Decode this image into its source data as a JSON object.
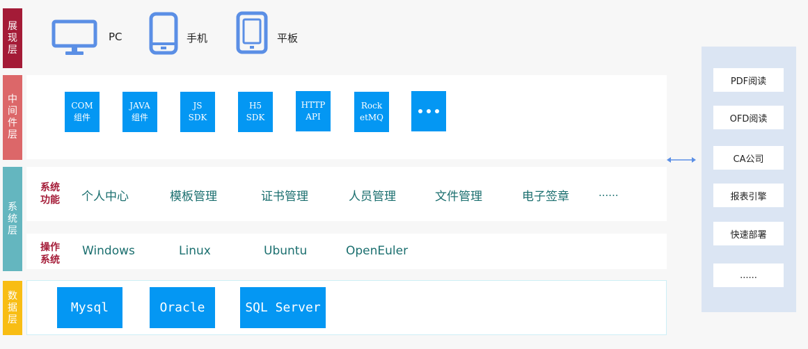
{
  "layers": {
    "presentation": "展现层",
    "middleware": "中间件层",
    "system": "系统层",
    "data": "数据层"
  },
  "devices": [
    {
      "label": "PC",
      "icon": "monitor-icon"
    },
    {
      "label": "手机",
      "icon": "phone-icon"
    },
    {
      "label": "平板",
      "icon": "tablet-icon"
    }
  ],
  "middleware_items": [
    {
      "line1": "COM",
      "line2": "组件"
    },
    {
      "line1": "JAVA",
      "line2": "组件"
    },
    {
      "line1": "JS",
      "line2": "SDK"
    },
    {
      "line1": "H5",
      "line2": "SDK"
    },
    {
      "line1": "HTTP",
      "line2": "API"
    },
    {
      "line1": "Rock",
      "line2": "etMQ"
    }
  ],
  "middleware_more_icon": "ellipsis-icon",
  "system": {
    "func_label": "系统功能",
    "func_items": [
      "个人中心",
      "模板管理",
      "证书管理",
      "人员管理",
      "文件管理",
      "电子签章",
      "......"
    ],
    "os_label": "操作系统",
    "os_items": [
      "Windows",
      "Linux",
      "Ubuntu",
      "OpenEuler"
    ]
  },
  "databases": [
    "Mysql",
    "Oracle",
    "SQL Server"
  ],
  "side_items": [
    "PDF阅读",
    "OFD阅读",
    "CA公司",
    "报表引擎",
    "快速部署",
    "......"
  ],
  "colors": {
    "presentation": "#a41b37",
    "middleware": "#dc6769",
    "system": "#64b6bf",
    "data": "#f8bd14",
    "accent_blue": "#0497f3",
    "icon_blue": "#5b8fe5",
    "side_panel": "#dbe5f3"
  }
}
